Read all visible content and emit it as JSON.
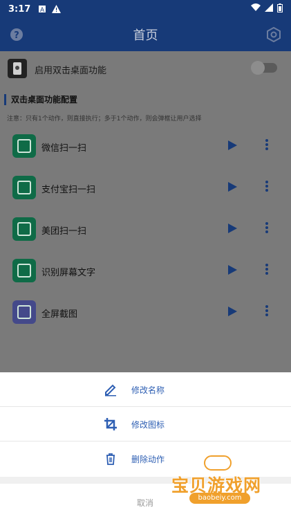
{
  "status_bar": {
    "time": "3:17"
  },
  "app_bar": {
    "title": "首页",
    "help_icon": "help-circle-icon",
    "settings_icon": "settings-hexagon-icon"
  },
  "toggle": {
    "label": "启用双击桌面功能",
    "enabled": false
  },
  "section": {
    "title": "双击桌面功能配置",
    "note": "注意：只有1个动作，则直接执行；多于1个动作，则会弹框让用户选择"
  },
  "actions": [
    {
      "name": "微信扫一扫",
      "icon": "wechat-scan-icon",
      "color": "#0f6b47"
    },
    {
      "name": "支付宝扫一扫",
      "icon": "alipay-scan-icon",
      "color": "#0f6b47"
    },
    {
      "name": "美团扫一扫",
      "icon": "meituan-scan-icon",
      "color": "#0f6b47"
    },
    {
      "name": "识别屏幕文字",
      "icon": "ocr-icon",
      "color": "#0f6b47"
    },
    {
      "name": "全屏截图",
      "icon": "screenshot-icon",
      "color": "#44498a"
    }
  ],
  "sheet": {
    "items": [
      {
        "label": "修改名称",
        "icon": "edit-pencil-icon"
      },
      {
        "label": "修改图标",
        "icon": "crop-icon"
      },
      {
        "label": "删除动作",
        "icon": "trash-icon"
      }
    ],
    "cancel": "取消"
  },
  "watermark": {
    "text": "宝贝游戏网",
    "url": "baobeiy.com"
  },
  "colors": {
    "primary": "#173a78",
    "accent": "#2e5fb3",
    "green": "#0f6b47",
    "watermark": "#f0a02c"
  }
}
